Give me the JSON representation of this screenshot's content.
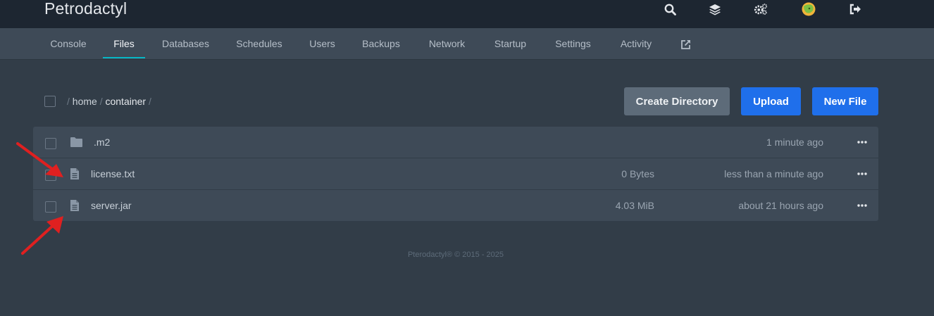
{
  "app": {
    "brand": "Petrodactyl"
  },
  "topbar": {
    "icons": [
      "search-icon",
      "layers-icon",
      "cogs-icon",
      "avatar",
      "sign-out-icon"
    ]
  },
  "tabs": [
    {
      "label": "Console"
    },
    {
      "label": "Files",
      "active": true
    },
    {
      "label": "Databases"
    },
    {
      "label": "Schedules"
    },
    {
      "label": "Users"
    },
    {
      "label": "Backups"
    },
    {
      "label": "Network"
    },
    {
      "label": "Startup"
    },
    {
      "label": "Settings"
    },
    {
      "label": "Activity"
    }
  ],
  "breadcrumb": {
    "separator": "/",
    "segments": [
      "home",
      "container"
    ]
  },
  "actions": {
    "create_directory": "Create Directory",
    "upload": "Upload",
    "new_file": "New File"
  },
  "files": [
    {
      "name": ".m2",
      "type": "folder",
      "size": "",
      "modified": "1 minute ago"
    },
    {
      "name": "license.txt",
      "type": "file",
      "size": "0 Bytes",
      "modified": "less than a minute ago"
    },
    {
      "name": "server.jar",
      "type": "file",
      "size": "4.03 MiB",
      "modified": "about 21 hours ago"
    }
  ],
  "footer": {
    "text": "Pterodactyl® © 2015 - 2025"
  },
  "colors": {
    "accent": "#06b6c4",
    "primary_button": "#1f6feb",
    "annotation_arrow": "#e02020"
  }
}
